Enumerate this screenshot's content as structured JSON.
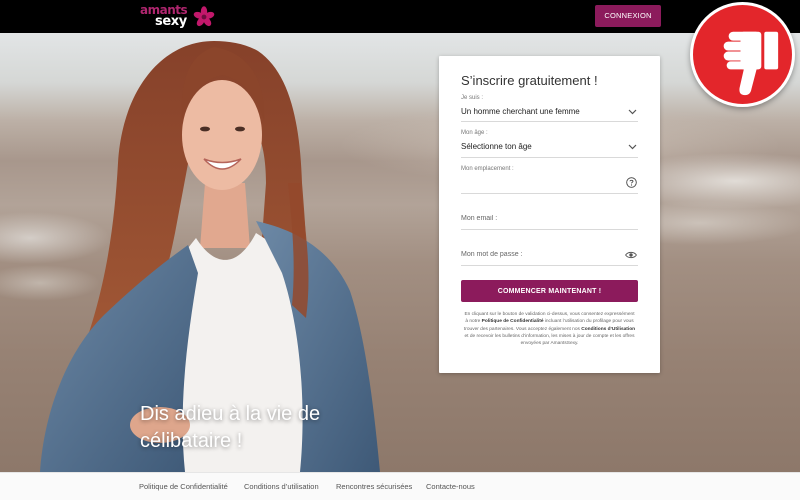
{
  "colors": {
    "brand": "#8c1b5c",
    "badge_red": "#e3262b",
    "topbar": "#000000"
  },
  "header": {
    "logo_line1": "amants",
    "logo_line2": "sexy",
    "logo_icon": "flower-icon",
    "login_label": "CONNEXION"
  },
  "badge": {
    "icon": "thumbs-down-icon"
  },
  "hero": {
    "tagline_line1": "Dis adieu à la vie de",
    "tagline_line2": "célibataire !"
  },
  "signup": {
    "title": "S’inscrire gratuitement !",
    "gender": {
      "label": "Je suis :",
      "value": "Un homme cherchant une femme",
      "icon": "chevron-down-icon"
    },
    "age": {
      "label": "Mon âge :",
      "value": "Sélectionne ton âge",
      "icon": "chevron-down-icon"
    },
    "location": {
      "label": "Mon emplacement :",
      "icon": "question-circle-icon"
    },
    "email": {
      "placeholder": "Mon email :"
    },
    "password": {
      "placeholder": "Mon mot de passe :",
      "icon": "eye-icon"
    },
    "submit_label": "COMMENCER MAINTENANT !",
    "legal": {
      "text1": "En cliquant sur le bouton de validation ci-dessus, vous consentez expressément à notre ",
      "link1": "Politique de Confidentialité",
      "text2": " incluant l’utilisation du profilage pour vous trouver des partenaires. Vous acceptez également nos ",
      "link2": "Conditions d’Utilisation",
      "text3": " et de recevoir les bulletins d’information, les mises à jour de compte et les offres envoyées par AmantsSexy."
    }
  },
  "footer": {
    "links": [
      "Politique de Confidentialité",
      "Conditions d’utilisation",
      "Rencontres sécurisées",
      "Contacte-nous"
    ]
  }
}
